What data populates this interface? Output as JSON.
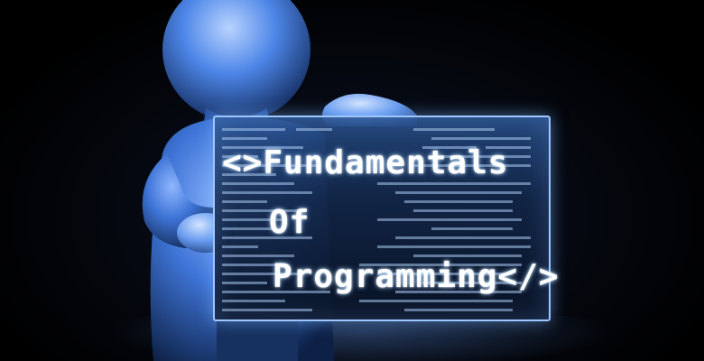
{
  "image": {
    "title_line1": "Fundamentals",
    "title_line2": "Of",
    "title_line3": "Programming",
    "open_tag": "<>",
    "close_tag": "</>"
  },
  "colors": {
    "figure": "#4f86e0",
    "panel_border": "#9ec7ff",
    "background": "#000000"
  }
}
